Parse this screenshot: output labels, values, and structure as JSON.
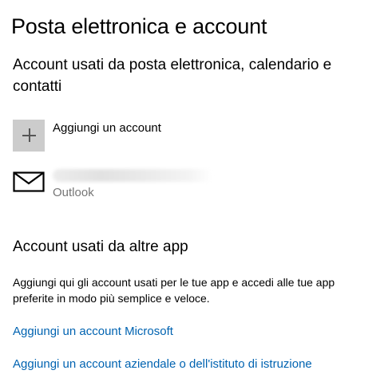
{
  "page": {
    "title": "Posta elettronica e account"
  },
  "email_section": {
    "heading": "Account usati da posta elettronica, calendario e contatti",
    "add_account": {
      "label": "Aggiungi un account",
      "icon": "plus-icon"
    },
    "accounts": [
      {
        "icon": "mail-icon",
        "email": "",
        "email_obscured": true,
        "type": "Outlook"
      }
    ]
  },
  "other_apps_section": {
    "heading": "Account usati da altre app",
    "description": "Aggiungi qui gli account usati per le tue app e accedi alle tue app preferite in modo più semplice e veloce.",
    "links": {
      "microsoft": "Aggiungi un account Microsoft",
      "work_school": "Aggiungi un account aziendale o dell'istituto di istruzione"
    }
  },
  "colors": {
    "background": "#ffffff",
    "text": "#000000",
    "secondary_text": "#767676",
    "link": "#0063b1",
    "add_tile": "#cccccc"
  }
}
